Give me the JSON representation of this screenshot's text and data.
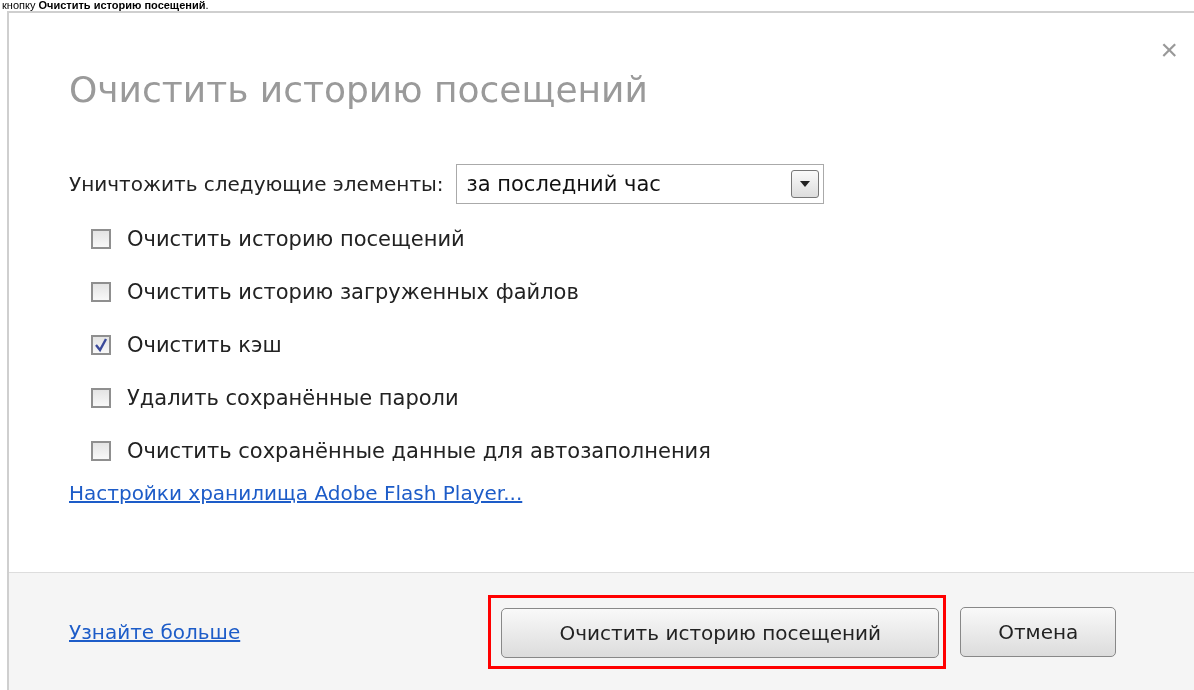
{
  "caption": "кнопку **Очистить историю посещений**.",
  "dialog": {
    "title": "Очистить историю посещений",
    "close": "×",
    "range": {
      "label": "Уничтожить следующие элементы:",
      "value": "за последний час"
    },
    "options": [
      {
        "label": "Очистить историю посещений",
        "checked": false
      },
      {
        "label": "Очистить историю загруженных файлов",
        "checked": false
      },
      {
        "label": "Очистить кэш",
        "checked": true
      },
      {
        "label": "Удалить сохранённые пароли",
        "checked": false
      },
      {
        "label": "Очистить сохранённые данные для автозаполнения",
        "checked": false
      }
    ],
    "flash_link": "Настройки хранилища Adobe Flash Player...",
    "footer": {
      "learn_more": "Узнайте больше",
      "buttons": [
        {
          "label": "Очистить историю посещений",
          "highlighted": true
        },
        {
          "label": "Отмена",
          "highlighted": false
        }
      ]
    }
  }
}
